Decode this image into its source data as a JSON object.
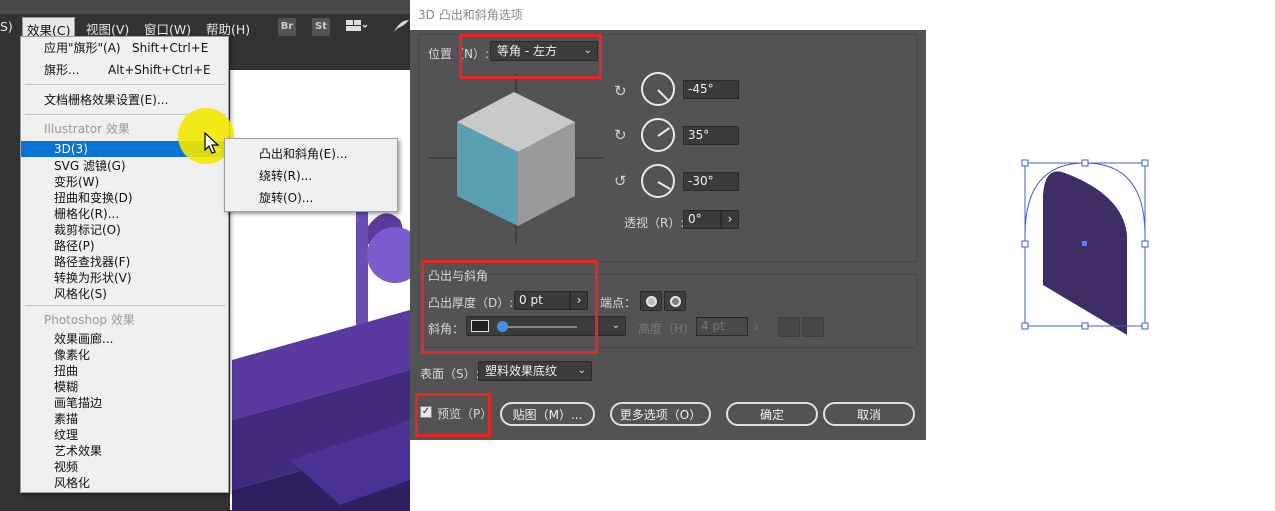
{
  "menubar": {
    "items": [
      "S)",
      "效果(C)",
      "视图(V)",
      "窗口(W)",
      "帮助(H)"
    ],
    "tool_icons": [
      "Br",
      "St"
    ]
  },
  "effect_menu": {
    "apply_last": {
      "label": "应用\"旗形\"(A)",
      "shortcut": "Shift+Ctrl+E"
    },
    "last": {
      "label": "旗形...",
      "shortcut": "Alt+Shift+Ctrl+E"
    },
    "raster_settings": "文档栅格效果设置(E)...",
    "illustrator_header": "Illustrator 效果",
    "illustrator_items": [
      "3D(3)",
      "SVG 滤镜(G)",
      "变形(W)",
      "扭曲和变换(D)",
      "栅格化(R)...",
      "裁剪标记(O)",
      "路径(P)",
      "路径查找器(F)",
      "转换为形状(V)",
      "风格化(S)"
    ],
    "photoshop_header": "Photoshop 效果",
    "photoshop_items": [
      "效果画廊...",
      "像素化",
      "扭曲",
      "模糊",
      "画笔描边",
      "素描",
      "纹理",
      "艺术效果",
      "视频",
      "风格化"
    ],
    "highlighted": "3D(3)"
  },
  "submenu_3d": {
    "items": [
      "凸出和斜角(E)...",
      "绕转(R)...",
      "旋转(O)..."
    ]
  },
  "dialog": {
    "title": "3D 凸出和斜角选项",
    "position_label": "位置（N）:",
    "position_value": "等角 - 左方",
    "rot_x": "-45°",
    "rot_y": "35°",
    "rot_z": "-30°",
    "perspective_label": "透视（R）:",
    "perspective_value": "0°",
    "extrude_section": "凸出与斜角",
    "extrude_depth_label": "凸出厚度（D）:",
    "extrude_depth_value": "0 pt",
    "cap_label": "端点：",
    "bevel_label": "斜角：",
    "height_label": "高度（H）:",
    "height_value": "4 pt",
    "surface_label": "表面（S）:",
    "surface_value": "塑料效果底纹",
    "preview_label": "预览（P）",
    "preview_checked": true,
    "buttons": {
      "map": "贴图（M）...",
      "more": "更多选项（O）",
      "ok": "确定",
      "cancel": "取消"
    }
  },
  "colors": {
    "menu_highlight": "#0a74d6",
    "annotation_red": "#e8262a",
    "shape_purple": "#3f2d66",
    "cube_left": "#5b9fb3",
    "cube_top": "#c9c9c9",
    "cube_right": "#9a9a9a",
    "selection_blue": "#3a62d8",
    "cursor_highlight": "#f3e800"
  }
}
